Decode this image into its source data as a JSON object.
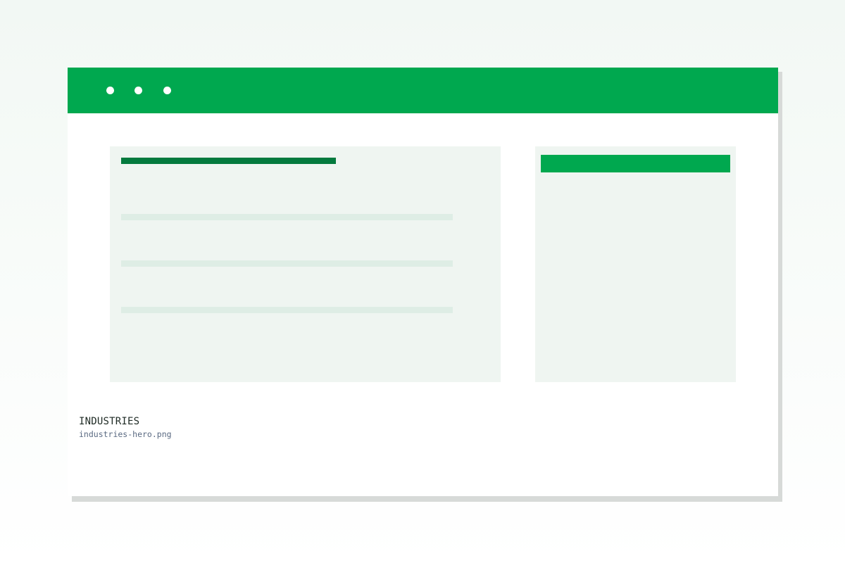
{
  "colors": {
    "titlebar": "#00a84f",
    "window_dots": "#ffffff",
    "panel_background": "#eff5f1",
    "heading_bar": "#047a3e",
    "text_line": "#deede5",
    "side_header_bar": "#00a84f"
  },
  "window": {
    "dots": [
      "window-dot",
      "window-dot",
      "window-dot"
    ]
  },
  "caption": {
    "title": "INDUSTRIES",
    "filename": "industries-hero.png"
  }
}
